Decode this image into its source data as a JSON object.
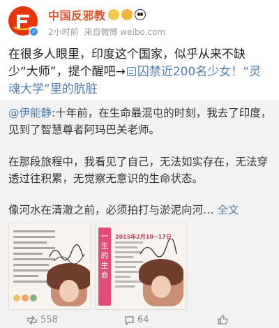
{
  "post": {
    "author": "中国反邪教",
    "time": "2小时前",
    "source": "来自微博 weibo.com",
    "text_part1": "在很多人眼里，印度这个国家，似乎从来不缺少“大师”，提个醒吧→",
    "link_text": "囚禁近200名少女！“灵魂大学”里的肮脏"
  },
  "repost": {
    "mention": "@伊能静",
    "para1": ":十年前，在生命最混屯的时刻，我去了印度，见到了智慧尊者阿玛巴关老师。",
    "para2": "在那段旅程中，我看见了自己，无法如实存在，无法穿透过往积累，无觉察无意识的生命状态。",
    "para3": "像河水在清澈之前，必须拍打与淤泥向河…",
    "more": "全文",
    "thumb2_banner": "一生的生命",
    "thumb2_date": "2015年2月10~17日"
  },
  "actions": {
    "repost_count": "558",
    "comment_count": "64"
  },
  "colors": {
    "author": "#e1512a",
    "link": "#507daf",
    "repost_bg": "#f2f2f2"
  }
}
